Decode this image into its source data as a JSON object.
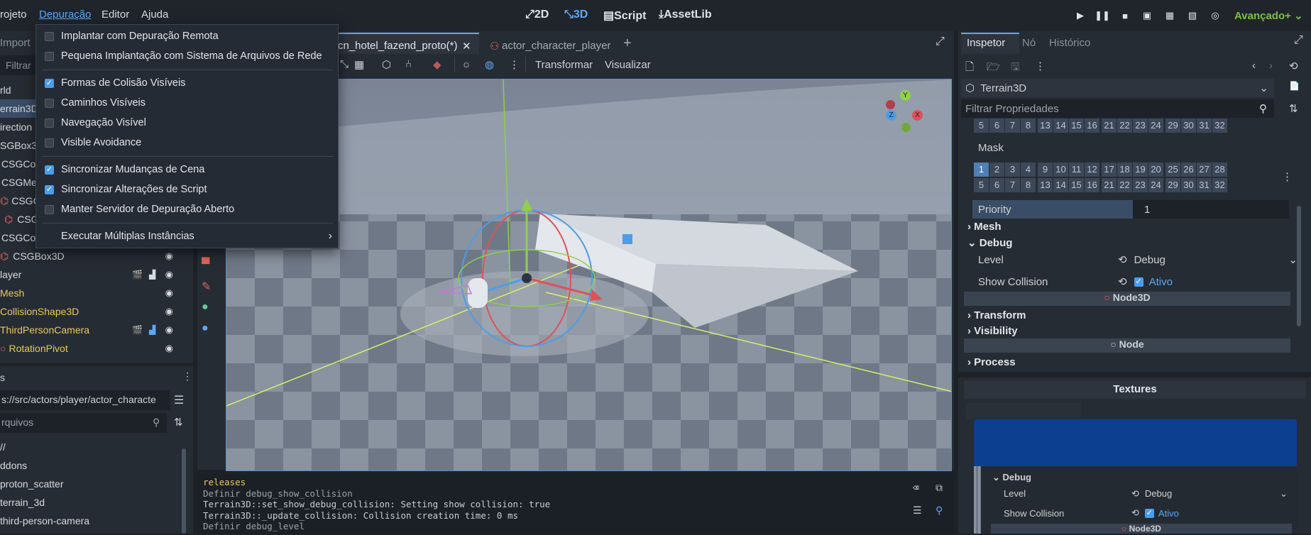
{
  "menus": [
    "rojeto",
    "Depuração",
    "Editor",
    "Ajuda"
  ],
  "workspaces": [
    "2D",
    "3D",
    "Script",
    "AssetLib"
  ],
  "renderer": "Avançado+",
  "debug_menu": {
    "items": [
      {
        "label": "Implantar com Depuração Remota",
        "checked": false
      },
      {
        "label": "Pequena Implantação com Sistema de Arquivos de Rede",
        "checked": false
      },
      {
        "label": "Formas de Colisão Visíveis",
        "checked": true
      },
      {
        "label": "Caminhos Visíveis",
        "checked": false
      },
      {
        "label": "Navegação Visível",
        "checked": false
      },
      {
        "label": "Visible Avoidance",
        "checked": false
      },
      {
        "label": "Sincronizar Mudanças de Cena",
        "checked": true
      },
      {
        "label": "Sincronizar Alterações de Script",
        "checked": true
      },
      {
        "label": "Manter Servidor de Depuração Aberto",
        "checked": false
      }
    ],
    "submenu": "Executar Múltiplas Instâncias",
    "submenu_arrow": "›"
  },
  "left_panel": {
    "tab_import": "Import",
    "filter_placeholder": "Filtrar",
    "scene_nodes": [
      "rld",
      "errain3D",
      "irection",
      "SGBox3",
      "CSGCor",
      "CSGMe",
      "CSGC",
      "CSG",
      "CSGCor",
      "CSGBox3D",
      "layer",
      "Mesh",
      "CollisionShape3D",
      "ThirdPersonCamera",
      "RotationPivot"
    ],
    "fs_title": "s",
    "path": "s://src/actors/player/actor_characte",
    "files_placeholder": "rquivos",
    "files": [
      "//",
      "ddons",
      "proton_scatter",
      "terrain_3d",
      "third-person-camera"
    ]
  },
  "scene_tabs": [
    {
      "label": "cn_hotel_fazend_proto(*)",
      "close": "✕"
    },
    {
      "label": "actor_character_player"
    }
  ],
  "viewport_menu": {
    "transform": "Transformar",
    "view": "Visualizar"
  },
  "gizmo_labels": {
    "y": "Y",
    "x": "X",
    "z": "Z"
  },
  "console_lines": [
    "releases",
    "Definir debug_show_collision",
    "Terrain3D::set_show_debug_collision: Setting show collision: true",
    "Terrain3D::_update_collision: Collision creation time: 0 ms",
    "Definir debug_level"
  ],
  "inspector": {
    "tabs": [
      "Inspetor",
      "Nó",
      "Histórico"
    ],
    "node_name": "Terrain3D",
    "filter_placeholder": "Filtrar Propriedades",
    "layer_rows_top": [
      "5",
      "6",
      "7",
      "8",
      "13",
      "14",
      "15",
      "16",
      "21",
      "22",
      "23",
      "24",
      "29",
      "30",
      "31",
      "32"
    ],
    "mask_label": "Mask",
    "mask_row1": [
      "1",
      "2",
      "3",
      "4",
      "9",
      "10",
      "11",
      "12",
      "17",
      "18",
      "19",
      "20",
      "25",
      "26",
      "27",
      "28"
    ],
    "mask_row2": [
      "5",
      "6",
      "7",
      "8",
      "13",
      "14",
      "15",
      "16",
      "21",
      "22",
      "23",
      "24",
      "29",
      "30",
      "31",
      "32"
    ],
    "priority_label": "Priority",
    "priority_value": "1",
    "sections": [
      "Mesh",
      "Debug",
      "Transform",
      "Visibility",
      "Process"
    ],
    "level_label": "Level",
    "level_value": "Debug",
    "show_collision_label": "Show Collision",
    "show_collision_value": "Ativo",
    "node3d_header": "Node3D",
    "node_header": "Node"
  },
  "textures": {
    "title": "Textures",
    "debug_label": "Debug",
    "level_label": "Level",
    "level_value": "Debug",
    "show_collision_label": "Show Collision",
    "show_collision_value": "Ativo",
    "node3d_header": "Node3D"
  },
  "colors": {
    "accent": "#5fa8f0",
    "checkbox": "#4c9de8",
    "renderer": "#7fbf3f",
    "node_yellow": "#e8c95a"
  }
}
